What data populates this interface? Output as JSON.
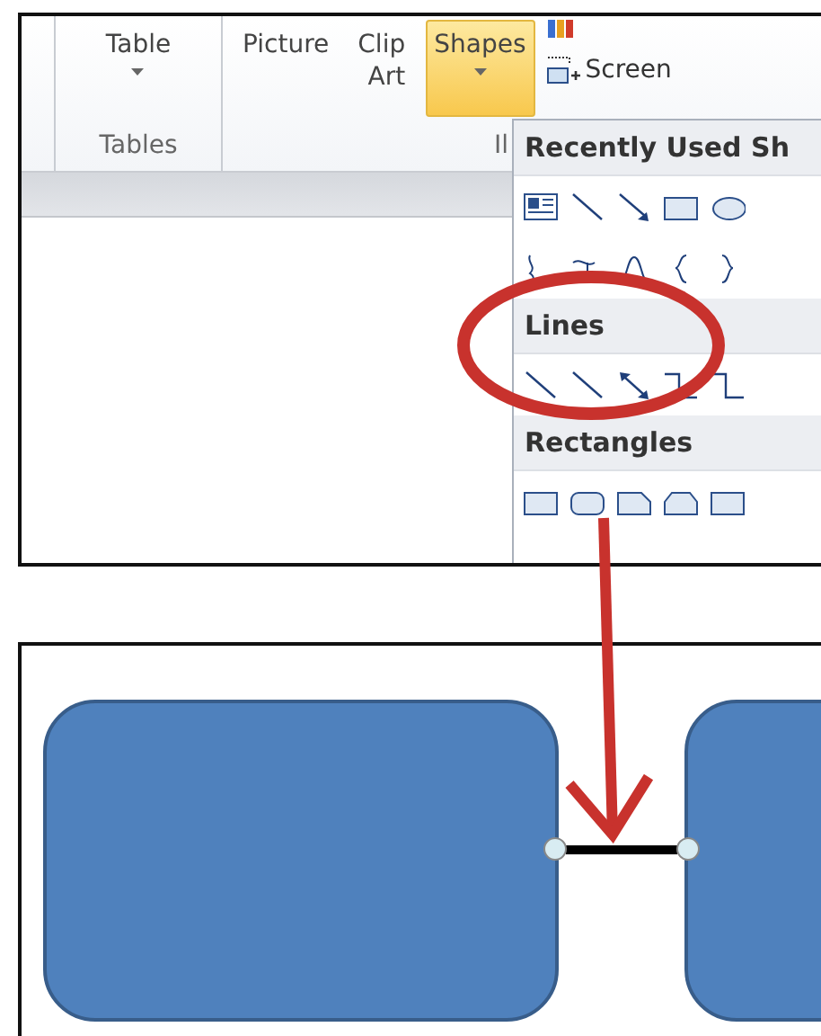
{
  "ribbon": {
    "groups": [
      {
        "label": "Tables",
        "buttons": [
          {
            "label": "Table",
            "dropdown": true,
            "selected": false
          }
        ]
      },
      {
        "label": "Il",
        "buttons": [
          {
            "label": "Picture",
            "dropdown": false,
            "selected": false
          },
          {
            "label": "Clip Art",
            "dropdown": false,
            "selected": false
          },
          {
            "label": "Shapes",
            "dropdown": true,
            "selected": true
          }
        ]
      }
    ],
    "small_buttons": [
      {
        "label": "Screen"
      }
    ]
  },
  "shapes_menu": {
    "sections": [
      {
        "title": "Recently Used Sh"
      },
      {
        "title": "Lines"
      },
      {
        "title": "Rectangles"
      }
    ]
  }
}
